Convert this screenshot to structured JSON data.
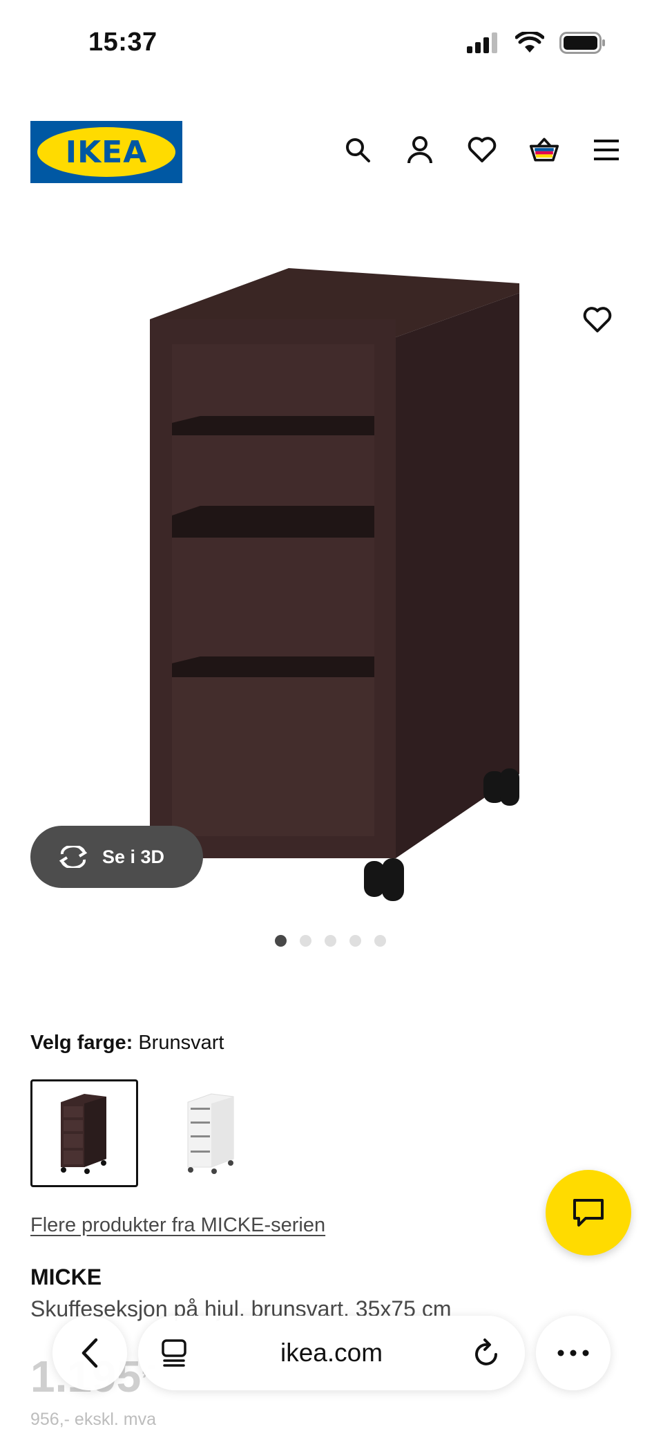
{
  "status_bar": {
    "time": "15:37",
    "icons": [
      "signal-icon",
      "wifi-icon",
      "battery-icon"
    ]
  },
  "header": {
    "logo_text": "IKEA",
    "icons": [
      "search-icon",
      "account-icon",
      "heart-icon",
      "basket-icon",
      "menu-icon"
    ],
    "brand_colors": {
      "blue": "#0058a3",
      "yellow": "#ffdb00"
    }
  },
  "gallery": {
    "see_3d_label": "Se i 3D",
    "dot_count": 5,
    "active_dot": 1
  },
  "color_select": {
    "label": "Velg farge:",
    "value": "Brunsvart",
    "options": [
      "Brunsvart",
      "Hvit"
    ],
    "selected": "Brunsvart"
  },
  "product": {
    "series_link": "Flere produkter fra MICKE-serien",
    "name": "MICKE",
    "description": "Skuffeseksjon på hjul, brunsvart, 35x75 cm",
    "price": "1.195",
    "price_suffix": ",-",
    "price_ex_vat": "956,- ekskl. mva"
  },
  "browser": {
    "url": "ikea.com",
    "icons": [
      "back-icon",
      "tabs-icon",
      "reload-icon",
      "more-icon"
    ]
  },
  "chat": {
    "icon": "chat-icon"
  }
}
